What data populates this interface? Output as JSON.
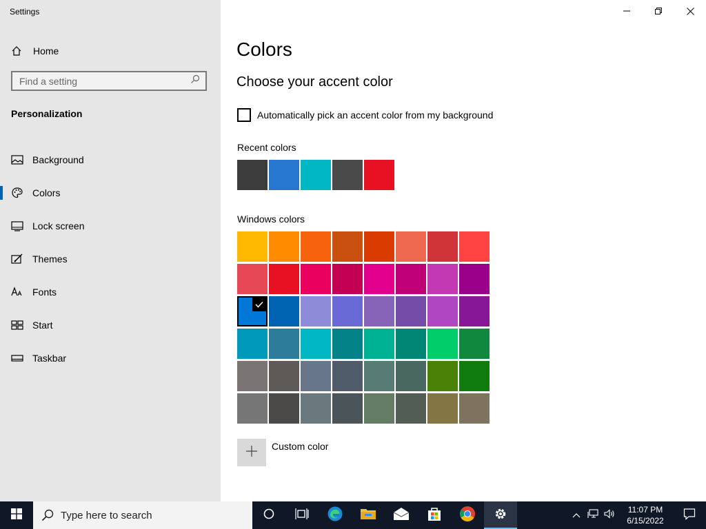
{
  "app": {
    "title": "Settings"
  },
  "sidebar": {
    "home_label": "Home",
    "search_placeholder": "Find a setting",
    "section": "Personalization",
    "items": [
      {
        "label": "Background",
        "icon": "image-icon"
      },
      {
        "label": "Colors",
        "icon": "palette-icon",
        "active": true
      },
      {
        "label": "Lock screen",
        "icon": "lock-screen-icon"
      },
      {
        "label": "Themes",
        "icon": "themes-icon"
      },
      {
        "label": "Fonts",
        "icon": "fonts-icon"
      },
      {
        "label": "Start",
        "icon": "start-icon"
      },
      {
        "label": "Taskbar",
        "icon": "taskbar-icon"
      }
    ]
  },
  "main": {
    "title": "Colors",
    "subtitle": "Choose your accent color",
    "auto_pick_label": "Automatically pick an accent color from my background",
    "recent_label": "Recent colors",
    "recent_colors": [
      "#3c3c3c",
      "#2677d0",
      "#00b7c3",
      "#4a4a4a",
      "#e81123"
    ],
    "windows_label": "Windows colors",
    "windows_colors": [
      [
        "#ffb900",
        "#ff8c00",
        "#f7630c",
        "#ca5010",
        "#da3b01",
        "#ef6950",
        "#d13438",
        "#ff4343"
      ],
      [
        "#e74856",
        "#e81123",
        "#ea005e",
        "#c30052",
        "#e3008c",
        "#bf0077",
        "#c239b3",
        "#9a0089"
      ],
      [
        "#0078d7",
        "#0063b1",
        "#8e8cd8",
        "#6b69d6",
        "#8764b8",
        "#744da9",
        "#b146c2",
        "#881798"
      ],
      [
        "#0099bc",
        "#2d7d9a",
        "#00b7c3",
        "#038387",
        "#00b294",
        "#018574",
        "#00cc6a",
        "#10893e"
      ],
      [
        "#7a7574",
        "#5d5a58",
        "#68768a",
        "#515c6b",
        "#567c73",
        "#486860",
        "#498205",
        "#107c10"
      ],
      [
        "#767676",
        "#4c4a48",
        "#69797e",
        "#4a5459",
        "#647c64",
        "#525e54",
        "#847545",
        "#7e735f"
      ]
    ],
    "selected_color": "#0078d7",
    "custom_color_label": "Custom color"
  },
  "taskbar": {
    "search_text": "Type here to search",
    "time": "11:07 PM",
    "date": "6/15/2022"
  }
}
